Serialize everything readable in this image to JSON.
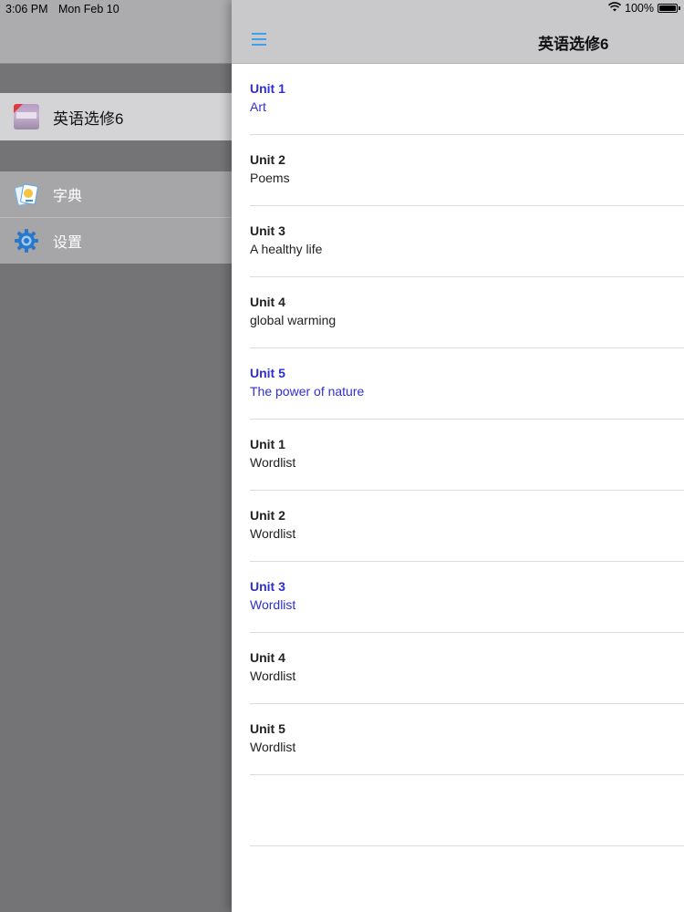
{
  "status_bar": {
    "time": "3:06 PM",
    "date": "Mon Feb 10",
    "battery": "100%",
    "battery_level": 1.0
  },
  "side_menu": {
    "book": {
      "label": "英语选修6",
      "icon": "book-cover-icon"
    },
    "items": [
      {
        "label": "字典",
        "icon": "dictionary-icon"
      },
      {
        "label": "设置",
        "icon": "gear-icon"
      }
    ]
  },
  "nav": {
    "title": "英语选修6",
    "menu_icon": "hamburger-menu-icon"
  },
  "colors": {
    "active_text": "#2f2fd0",
    "menu_icon": "#3fa0e8"
  },
  "units": [
    {
      "title": "Unit 1",
      "subtitle": "Art",
      "active": true
    },
    {
      "title": "Unit 2",
      "subtitle": "Poems",
      "active": false
    },
    {
      "title": "Unit 3",
      "subtitle": "A healthy life",
      "active": false
    },
    {
      "title": "Unit 4",
      "subtitle": "global warming",
      "active": false
    },
    {
      "title": "Unit 5",
      "subtitle": "The power of nature",
      "active": true
    },
    {
      "title": "Unit 1",
      "subtitle": "Wordlist",
      "active": false
    },
    {
      "title": "Unit 2",
      "subtitle": "Wordlist",
      "active": false
    },
    {
      "title": "Unit 3",
      "subtitle": "Wordlist",
      "active": true
    },
    {
      "title": "Unit 4",
      "subtitle": "Wordlist",
      "active": false
    },
    {
      "title": "Unit 5",
      "subtitle": "Wordlist",
      "active": false
    }
  ]
}
